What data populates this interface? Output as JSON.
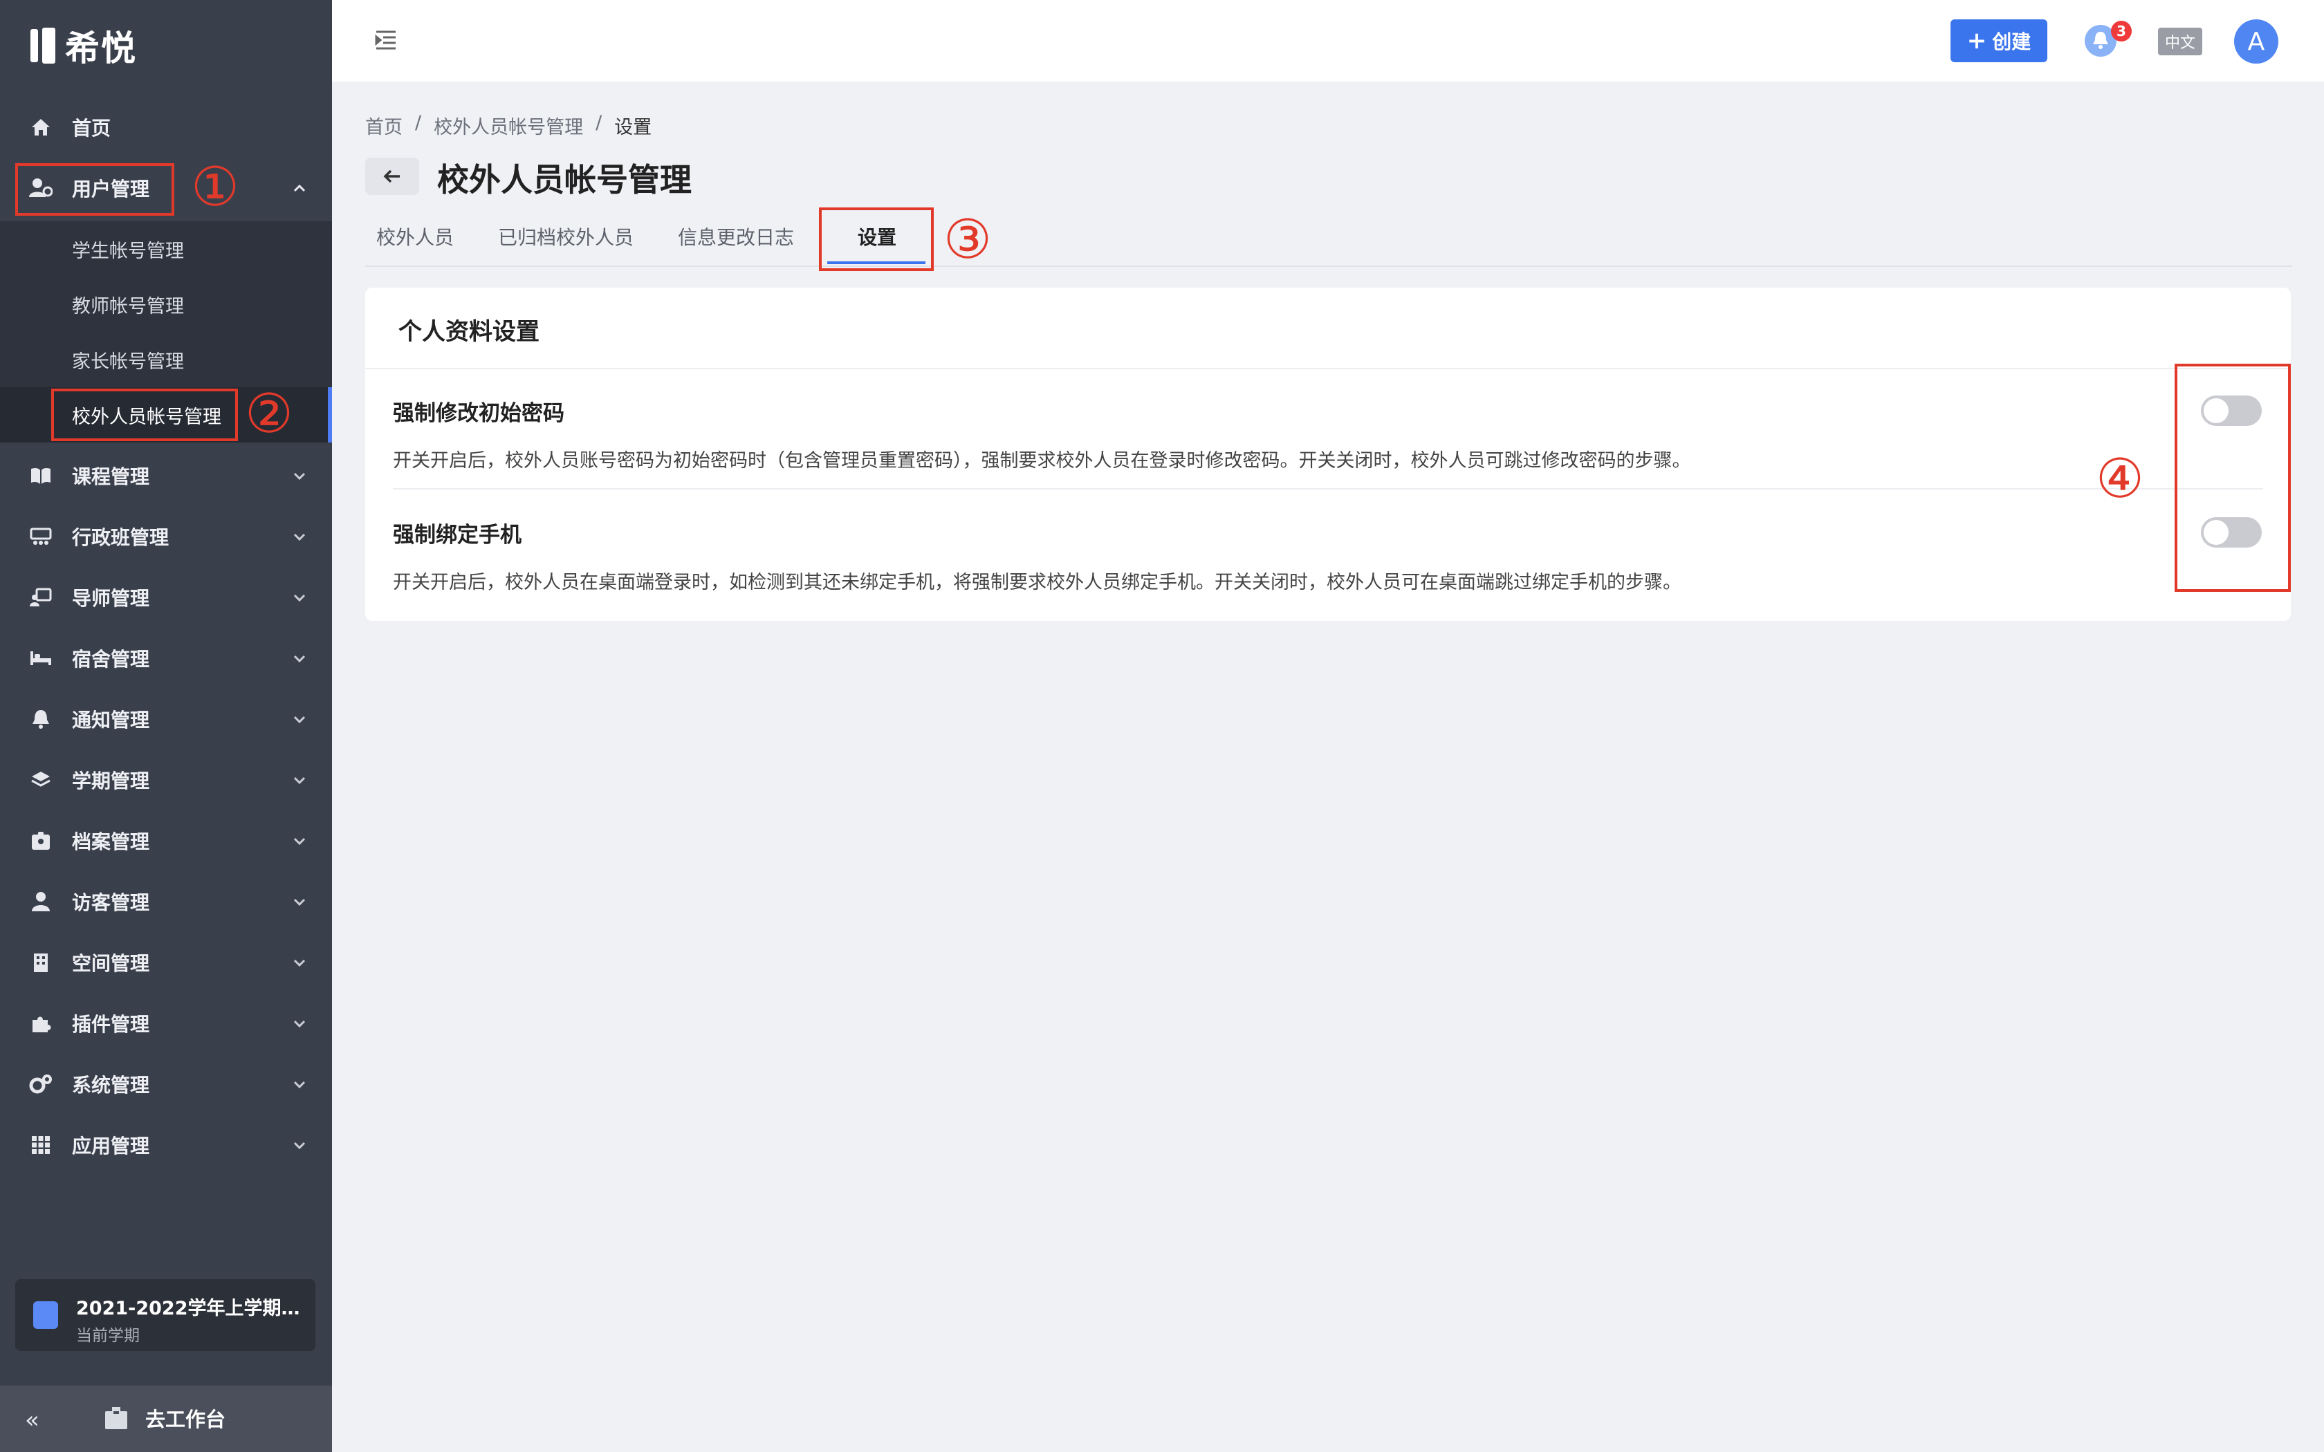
{
  "brand": {
    "name": "希悦"
  },
  "sidebar": {
    "items": [
      {
        "label": "首页",
        "icon": "home-icon"
      },
      {
        "label": "用户管理",
        "icon": "user-settings-icon",
        "expanded": true
      },
      {
        "label": "课程管理",
        "icon": "book-icon"
      },
      {
        "label": "行政班管理",
        "icon": "class-icon"
      },
      {
        "label": "导师管理",
        "icon": "mentor-icon"
      },
      {
        "label": "宿舍管理",
        "icon": "bed-icon"
      },
      {
        "label": "通知管理",
        "icon": "bell-icon"
      },
      {
        "label": "学期管理",
        "icon": "layers-icon"
      },
      {
        "label": "档案管理",
        "icon": "id-card-icon"
      },
      {
        "label": "访客管理",
        "icon": "visitor-icon"
      },
      {
        "label": "空间管理",
        "icon": "building-icon"
      },
      {
        "label": "插件管理",
        "icon": "puzzle-icon"
      },
      {
        "label": "系统管理",
        "icon": "gears-icon"
      },
      {
        "label": "应用管理",
        "icon": "apps-grid-icon"
      }
    ],
    "sub_items": [
      {
        "label": "学生帐号管理"
      },
      {
        "label": "教师帐号管理"
      },
      {
        "label": "家长帐号管理"
      },
      {
        "label": "校外人员帐号管理",
        "active": true
      }
    ],
    "term": {
      "title": "2021-2022学年上学期（...",
      "subtitle": "当前学期"
    },
    "footer": {
      "collapse": "«",
      "workbench": "去工作台"
    }
  },
  "topbar": {
    "create_label": "创建",
    "notification_count": "3",
    "language": "中文",
    "avatar_letter": "A"
  },
  "breadcrumb": [
    "首页",
    "校外人员帐号管理",
    "设置"
  ],
  "breadcrumb_separator": "/",
  "page_title": "校外人员帐号管理",
  "tabs": [
    {
      "label": "校外人员"
    },
    {
      "label": "已归档校外人员"
    },
    {
      "label": "信息更改日志"
    },
    {
      "label": "设置",
      "active": true
    }
  ],
  "settings_card": {
    "title": "个人资料设置",
    "settings": [
      {
        "title": "强制修改初始密码",
        "description": "开关开启后，校外人员账号密码为初始密码时（包含管理员重置密码），强制要求校外人员在登录时修改密码。开关关闭时，校外人员可跳过修改密码的步骤。",
        "enabled": false
      },
      {
        "title": "强制绑定手机",
        "description": "开关开启后，校外人员在桌面端登录时，如检测到其还未绑定手机，将强制要求校外人员绑定手机。开关关闭时，校外人员可在桌面端跳过绑定手机的步骤。",
        "enabled": false
      }
    ]
  },
  "annotations": [
    "①",
    "②",
    "③",
    "④"
  ],
  "colors": {
    "sidebar": "#3a3f4c",
    "accent": "#3b75ee",
    "annotation": "#e23a2a"
  }
}
